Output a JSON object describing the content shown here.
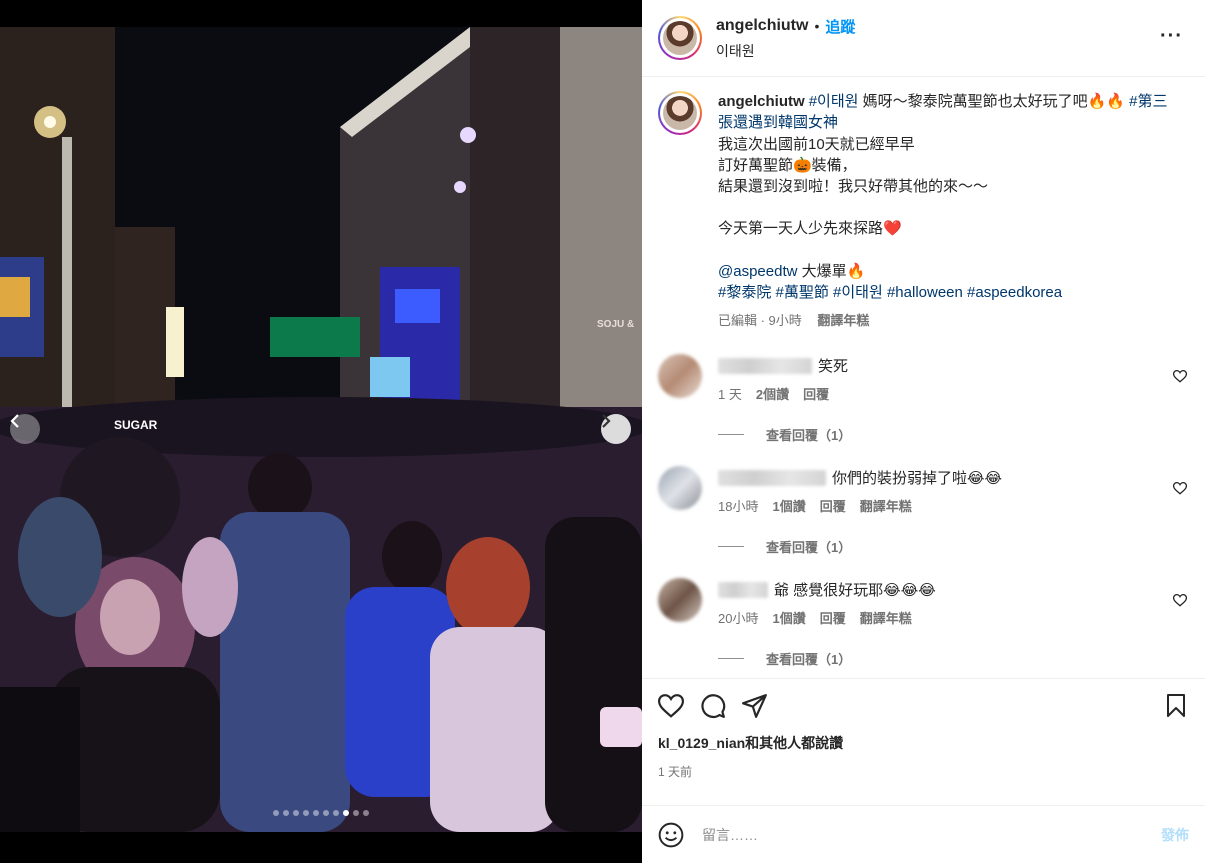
{
  "post": {
    "username": "angelchiutw",
    "separator": "•",
    "follow_label": "追蹤",
    "location": "이태원",
    "more_label": "···"
  },
  "caption": {
    "username": "angelchiutw",
    "line1_tag": "#이태원",
    "line1_text": " 媽呀～黎泰院萬聖節也太好玩了吧🔥🔥 ",
    "line1_tag2": "#第三張還遇到韓國女神",
    "line2": "我這次出國前10天就已經早早",
    "line3": "訂好萬聖節🎃裝備，",
    "line4": "結果還到沒到啦！我只好帶其他的來～～",
    "line5": "今天第一天人少先來探路❤️",
    "mention": "@aspeedtw",
    "mention_text": " 大爆單🔥",
    "tags": [
      "#黎泰院",
      "#萬聖節",
      "#이태원",
      "#halloween",
      "#aspeedkorea"
    ],
    "edited": "已編輯 · 9小時",
    "translate": "翻譯年糕"
  },
  "comments": [
    {
      "text": "笑死",
      "time": "1 天",
      "likes": "2個讚",
      "reply": "回覆",
      "translate": "",
      "view_replies": "查看回覆（1）"
    },
    {
      "text": "你們的裝扮弱掉了啦😂😂",
      "time": "18小時",
      "likes": "1個讚",
      "reply": "回覆",
      "translate": "翻譯年糕",
      "view_replies": "查看回覆（1）"
    },
    {
      "text": "爺 感覺很好玩耶😂😂😂",
      "time": "20小時",
      "likes": "1個讚",
      "reply": "回覆",
      "translate": "翻譯年糕",
      "view_replies": "查看回覆（1）"
    }
  ],
  "likes_text": "kl_0129_nian和其他人都說讚",
  "post_time": "1 天前",
  "comment_bar": {
    "placeholder": "留言……",
    "post_label": "發佈"
  },
  "media": {
    "slide_count": 10,
    "active_slide": 8,
    "signs": [
      "SUGAR",
      "SOJU &"
    ]
  }
}
